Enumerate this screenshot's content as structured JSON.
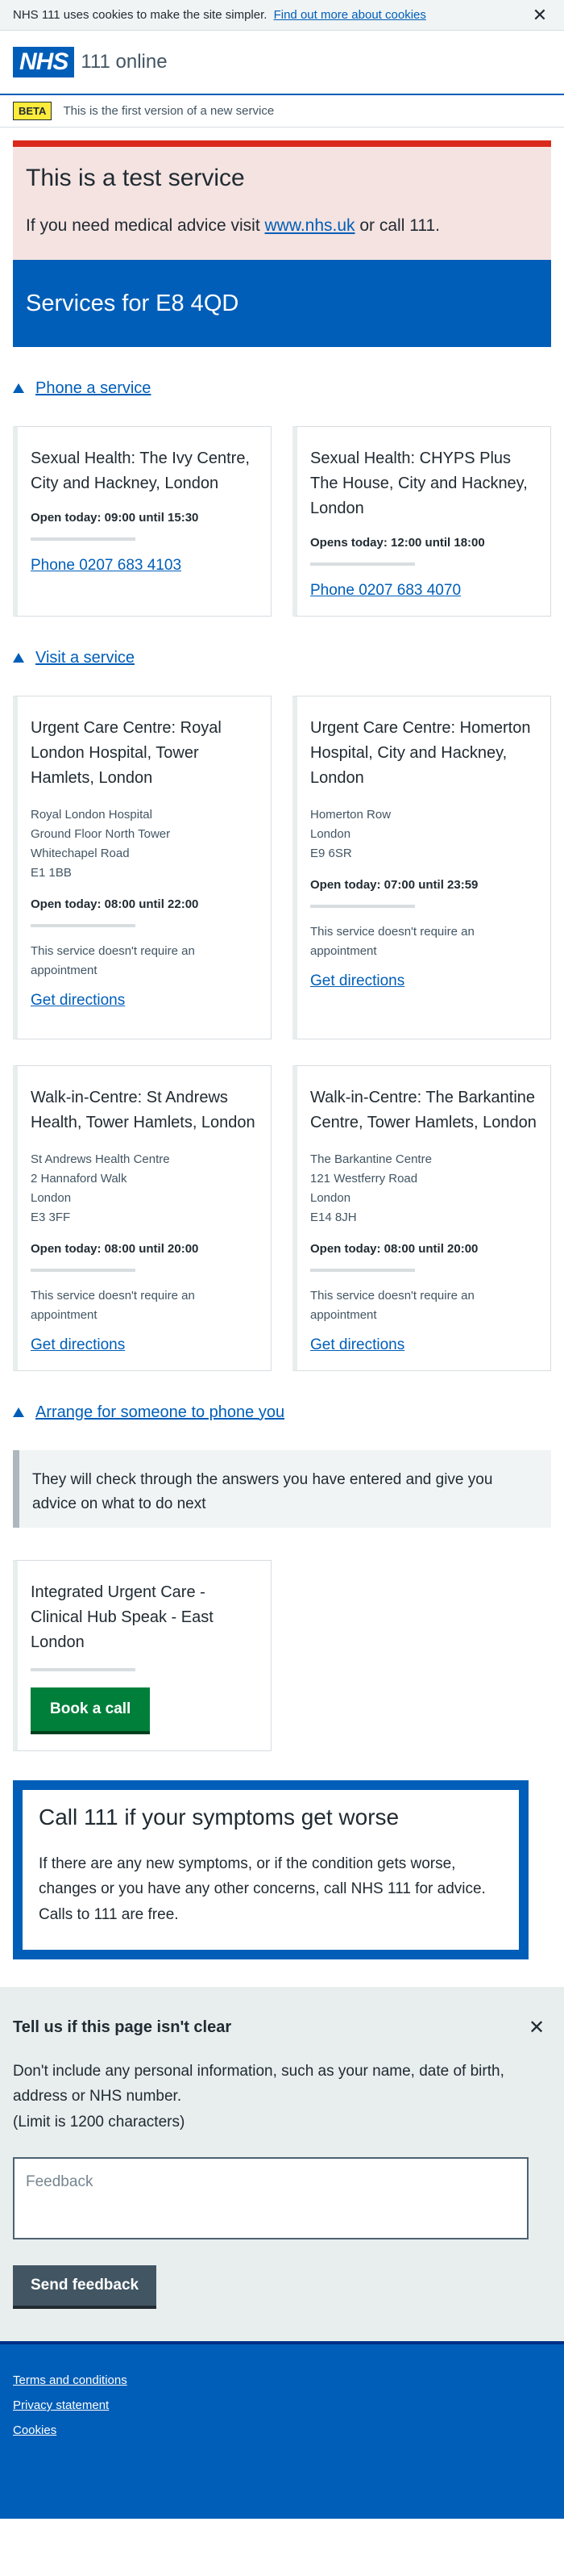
{
  "cookie": {
    "message": "NHS 111 uses cookies to make the site simpler.",
    "link": "Find out more about cookies",
    "close": "✕"
  },
  "header": {
    "logo": "NHS",
    "service": "111 online"
  },
  "beta": {
    "tag": "BETA",
    "text": "This is the first version of a new service"
  },
  "test_service": {
    "title": "This is a test service",
    "text_before": "If you need medical advice visit ",
    "link": "www.nhs.uk",
    "text_after": " or call 111."
  },
  "services_title": "Services for E8 4QD",
  "phone_section": {
    "label": "Phone a service",
    "cards": [
      {
        "name": "Sexual Health: The Ivy Centre, City and Hackney, London",
        "open": "Open today: 09:00 until 15:30",
        "phone": "Phone 0207 683 4103"
      },
      {
        "name": "Sexual Health: CHYPS Plus The House, City and Hackney, London",
        "open": "Opens today: 12:00 until 18:00",
        "phone": "Phone 0207 683 4070"
      }
    ]
  },
  "visit_section": {
    "label": "Visit a service",
    "cards": [
      {
        "name": "Urgent Care Centre: Royal London Hospital, Tower Hamlets, London",
        "address": [
          "Royal London Hospital",
          "Ground Floor North Tower",
          "Whitechapel Road",
          "E1 1BB"
        ],
        "open": "Open today: 08:00 until 22:00",
        "appt": "This service doesn't require an appointment",
        "directions": "Get directions"
      },
      {
        "name": "Urgent Care Centre: Homerton Hospital, City and Hackney, London",
        "address": [
          "Homerton Row",
          "London",
          "E9 6SR"
        ],
        "open": "Open today: 07:00 until 23:59",
        "appt": "This service doesn't require an appointment",
        "directions": "Get directions"
      },
      {
        "name": "Walk-in-Centre: St Andrews Health, Tower Hamlets, London",
        "address": [
          "St Andrews Health Centre",
          "2 Hannaford Walk",
          "London",
          "E3 3FF"
        ],
        "open": "Open today: 08:00 until 20:00",
        "appt": "This service doesn't require an appointment",
        "directions": "Get directions"
      },
      {
        "name": "Walk-in-Centre: The Barkantine Centre, Tower Hamlets, London",
        "address": [
          "The Barkantine Centre",
          "121 Westferry Road",
          "London",
          "E14 8JH"
        ],
        "open": "Open today: 08:00 until 20:00",
        "appt": "This service doesn't require an appointment",
        "directions": "Get directions"
      }
    ]
  },
  "callback_section": {
    "label": "Arrange for someone to phone you",
    "inset": "They will check through the answers you have entered and give you advice on what to do next",
    "card_name": "Integrated Urgent Care - Clinical Hub Speak - East London",
    "button": "Book a call"
  },
  "care_card": {
    "title": "Call 111 if your symptoms get worse",
    "text": "If there are any new symptoms, or if the condition gets worse, changes or you have any other concerns, call NHS 111 for advice. Calls to 111 are free."
  },
  "feedback": {
    "title": "Tell us if this page isn't clear",
    "close": "✕",
    "help": "Don't include any personal information, such as your name, date of birth, address or NHS number.",
    "limit": "(Limit is 1200 characters)",
    "placeholder": "Feedback",
    "button": "Send feedback"
  },
  "footer": {
    "links": [
      "Terms and conditions",
      "Privacy statement",
      "Cookies"
    ]
  }
}
